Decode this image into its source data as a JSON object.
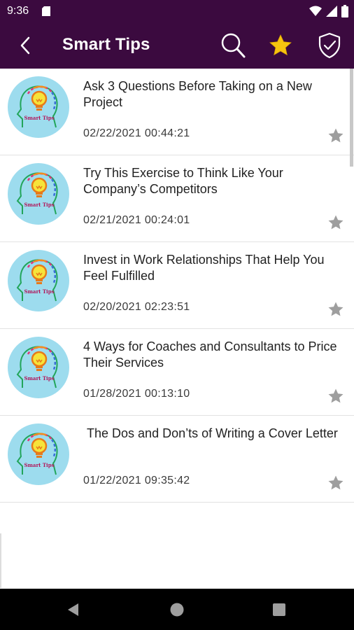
{
  "status_bar": {
    "time": "9:36"
  },
  "app_bar": {
    "title": "Smart Tips",
    "background_color": "#3b0a3f",
    "icons": [
      "back-arrow-icon",
      "search-icon",
      "star-icon",
      "shield-check-icon"
    ]
  },
  "avatar": {
    "caption": "Smart Tips"
  },
  "tips": [
    {
      "title": "Ask 3 Questions Before Taking on a New Project",
      "date": "02/22/2021 00:44:21"
    },
    {
      "title": "Try This Exercise to Think Like Your Company’s Competitors",
      "date": "02/21/2021 00:24:01"
    },
    {
      "title": "Invest in Work Relationships That Help You Feel Fulfilled",
      "date": "02/20/2021 02:23:51"
    },
    {
      "title": "4 Ways for Coaches and Consultants to Price Their Services",
      "date": "01/28/2021 00:13:10"
    },
    {
      "title": " The Dos and Don’ts of Writing a Cover Letter",
      "date": "01/22/2021 09:35:42"
    }
  ],
  "colors": {
    "accent_star": "#f6c40f",
    "fav_star": "#9e9e9e",
    "avatar_bg": "#9ddcee"
  }
}
